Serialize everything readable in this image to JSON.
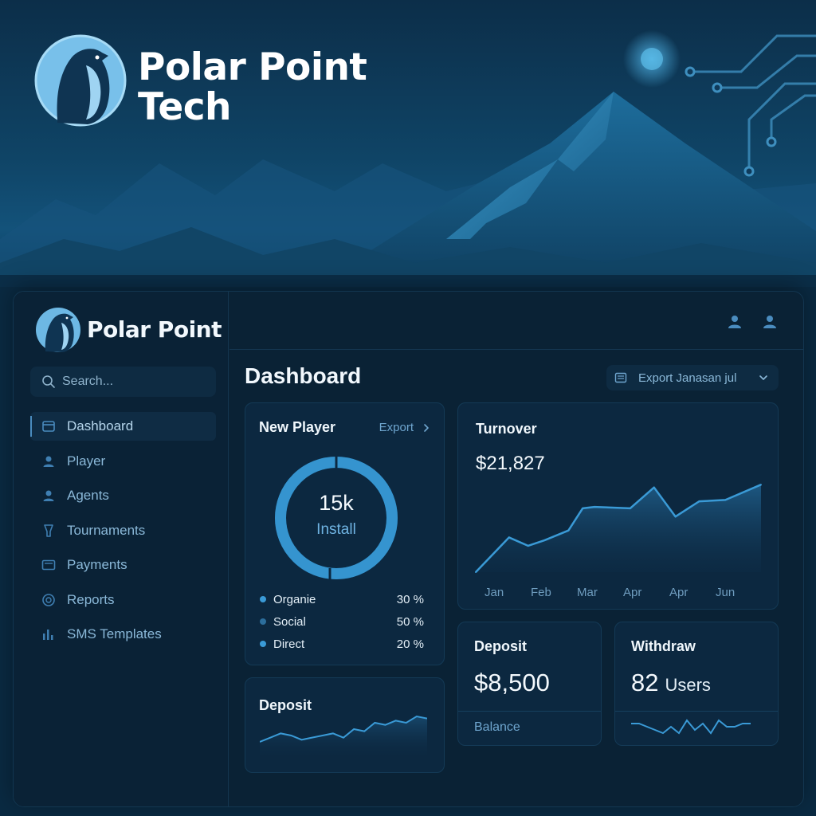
{
  "hero": {
    "title_line1": "Polar Point",
    "title_line2": "Tech"
  },
  "colors": {
    "accent": "#3a9ad6",
    "background": "#0a2235",
    "card": "#0c2840",
    "muted": "#8ab8d8"
  },
  "sidebar": {
    "brand": "Polar Point",
    "search_placeholder": "Search...",
    "items": [
      {
        "label": "Dashboard",
        "icon": "dashboard-icon",
        "active": true
      },
      {
        "label": "Player",
        "icon": "player-icon"
      },
      {
        "label": "Agents",
        "icon": "agents-icon"
      },
      {
        "label": "Tournaments",
        "icon": "tournaments-icon"
      },
      {
        "label": "Payments",
        "icon": "payments-icon"
      },
      {
        "label": "Reports",
        "icon": "reports-icon"
      },
      {
        "label": "SMS Templates",
        "icon": "sms-templates-icon"
      }
    ]
  },
  "header": {
    "page_title": "Dashboard",
    "export_select": "Export Janasan jul"
  },
  "new_player": {
    "title": "New Player",
    "export_label": "Export",
    "center_value": "15k",
    "center_label": "Install",
    "legend": [
      {
        "label": "Organie",
        "value": "30 %",
        "color": "#3a9ad6"
      },
      {
        "label": "Social",
        "value": "50 %",
        "color": "#2c6e9c"
      },
      {
        "label": "Direct",
        "value": "20 %",
        "color": "#3a9ad6"
      }
    ]
  },
  "turnover": {
    "title": "Turnover",
    "value": "$21,827"
  },
  "chart_data": {
    "type": "area",
    "title": "Turnover",
    "categories": [
      "Jan",
      "Feb",
      "Mar",
      "Apr",
      "Apr",
      "Jun"
    ],
    "x": [
      0,
      0.7,
      1.1,
      1.45,
      1.95,
      2.25,
      2.5,
      3.25,
      3.75,
      4.2,
      4.7,
      5.25,
      6.0
    ],
    "values": [
      0,
      25,
      19,
      23,
      30,
      46,
      47,
      46,
      61,
      40,
      51,
      52,
      63
    ],
    "ylim": [
      0,
      70
    ],
    "xlabel": "",
    "ylabel": "",
    "grid": false,
    "legend": false
  },
  "deposit_small": {
    "title": "Deposit",
    "sparkline": [
      10,
      12,
      14,
      13,
      11,
      12,
      13,
      14,
      12,
      16,
      15,
      19,
      18,
      20,
      19,
      22,
      21
    ]
  },
  "deposit": {
    "title": "Deposit",
    "value": "$8,500",
    "sub_label": "Balance"
  },
  "withdraw": {
    "title": "Withdraw",
    "value": "82",
    "unit": "Users",
    "sparkline": [
      12,
      12,
      11,
      10,
      9,
      11,
      9,
      13,
      10,
      12,
      9,
      13,
      11,
      11,
      12,
      12
    ]
  }
}
